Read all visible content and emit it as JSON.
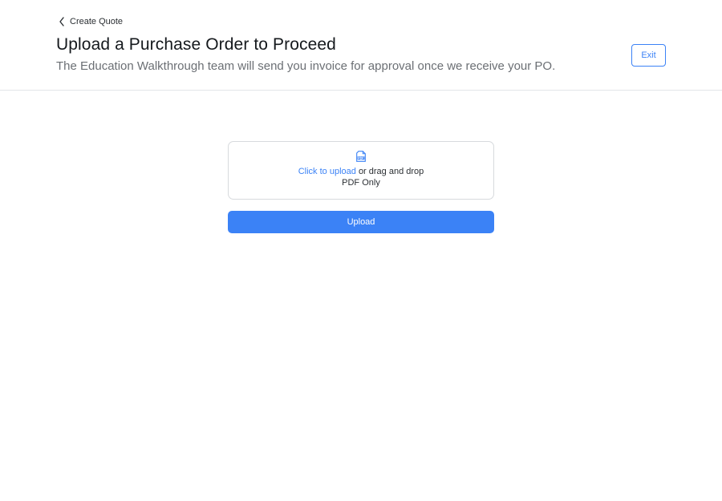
{
  "header": {
    "back_label": "Create Quote",
    "back_icon": "chevron-left-icon",
    "title": "Upload a Purchase Order to Proceed",
    "subtitle": "The Education Walkthrough team will send you invoice for approval once we receive your PO.",
    "exit_label": "Exit"
  },
  "dropzone": {
    "icon": "pdf-file-icon",
    "click_label": "Click to upload",
    "drag_label": "or drag and drop",
    "hint": "PDF Only"
  },
  "upload_label": "Upload",
  "colors": {
    "accent": "#3b82f6",
    "text_primary": "#15191d",
    "text_secondary": "#6b6f74",
    "border": "#d7dadd"
  }
}
